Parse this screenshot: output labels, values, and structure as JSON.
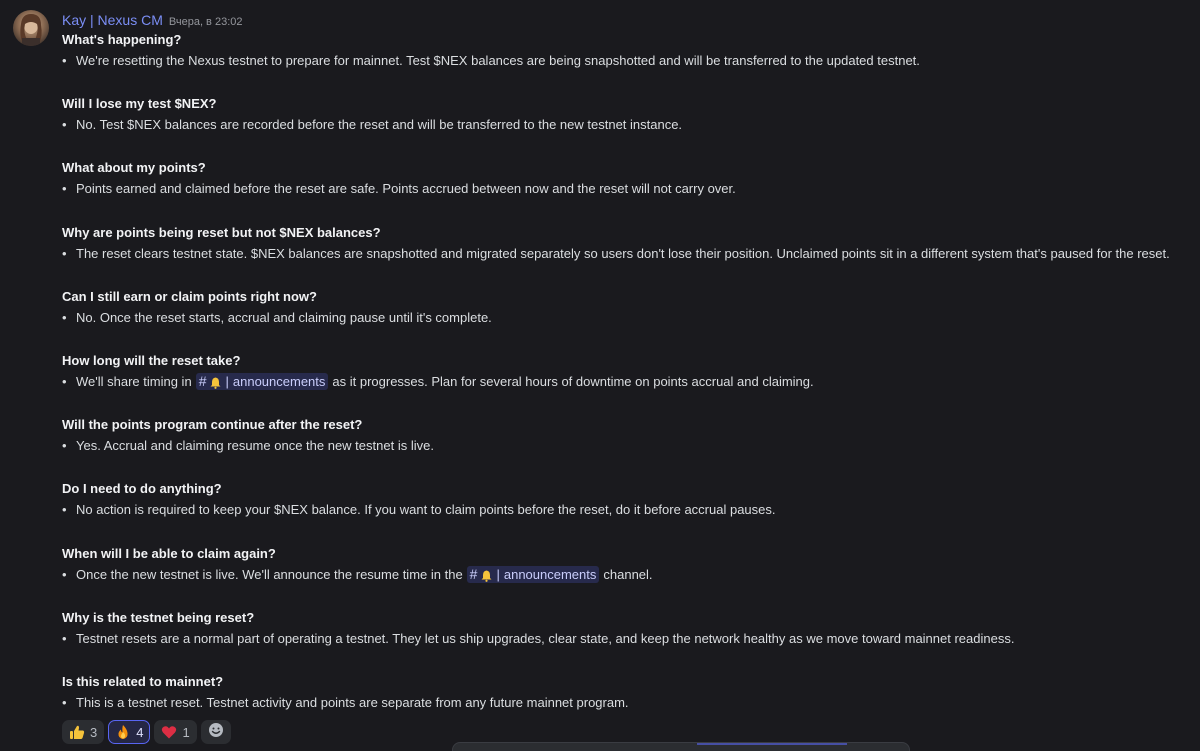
{
  "message": {
    "author": "Kay | Nexus CM",
    "timestamp": "Вчера, в 23:02",
    "colors": {
      "author": "#7b8ef5",
      "background": "#1a1a1e",
      "mention_bg": "#5865f2"
    }
  },
  "faq": [
    {
      "question": "What's happening?",
      "answer": "We're resetting the Nexus testnet to prepare for mainnet. Test $NEX balances are being snapshotted and will be transferred to the updated testnet."
    },
    {
      "question": "Will I lose my test $NEX?",
      "answer": "No. Test $NEX balances are recorded before the reset and will be transferred to the new testnet instance."
    },
    {
      "question": "What about my points?",
      "answer": "Points earned and claimed before the reset are safe. Points accrued between now and the reset will not carry over."
    },
    {
      "question": "Why are points being reset but not $NEX balances?",
      "answer": "The reset clears testnet state. $NEX balances are snapshotted and migrated separately so users don't lose their position. Unclaimed points sit in a different system that's paused for the reset."
    },
    {
      "question": "Can I still earn or claim points right now?",
      "answer": "No. Once the reset starts, accrual and claiming pause until it's complete."
    },
    {
      "question": "How long will the reset take?",
      "answer_before": "We'll share timing in",
      "mention": "announcements",
      "answer_after": "as it progresses. Plan for several hours of downtime on points accrual and claiming."
    },
    {
      "question": "Will the points program continue after the reset?",
      "answer": "Yes. Accrual and claiming resume once the new testnet is live."
    },
    {
      "question": "Do I need to do anything?",
      "answer": "No action is required to keep your $NEX balance. If you want to claim points before the reset, do it before accrual pauses."
    },
    {
      "question": "When will I be able to claim again?",
      "answer_before": "Once the new testnet is live. We'll announce the resume time in the",
      "mention": "announcements",
      "answer_after": "channel."
    },
    {
      "question": "Why is the testnet being reset?",
      "answer": "Testnet resets are a normal part of operating a testnet. They let us ship upgrades, clear state, and keep the network healthy as we move toward mainnet readiness."
    },
    {
      "question": "Is this related to mainnet?",
      "answer": "This is a testnet reset. Testnet activity and points are separate from any future mainnet program."
    }
  ],
  "reactions": [
    {
      "emoji": "thumbs-up-icon",
      "count": "3",
      "active": false
    },
    {
      "emoji": "fire-icon",
      "count": "4",
      "active": true
    },
    {
      "emoji": "heart-icon",
      "count": "1",
      "active": false
    }
  ],
  "channel_prefix": "#",
  "channel_separator": "|"
}
